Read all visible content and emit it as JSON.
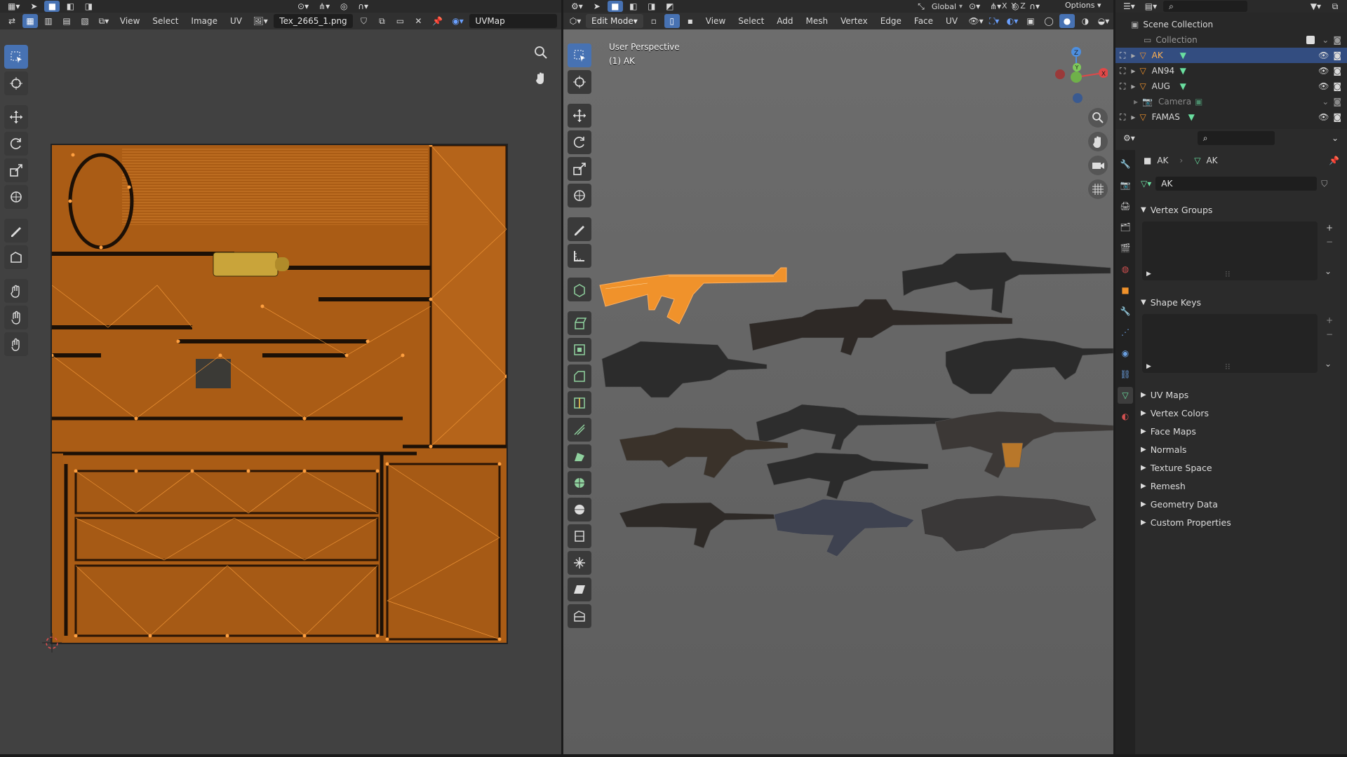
{
  "uv_editor": {
    "menus": [
      "View",
      "Select",
      "Image",
      "UV"
    ],
    "image_name": "Tex_2665_1.png",
    "uvmap_name": "UVMap"
  },
  "viewport": {
    "mode": "Edit Mode",
    "menus": [
      "View",
      "Select",
      "Add",
      "Mesh",
      "Vertex",
      "Edge",
      "Face",
      "UV"
    ],
    "transform_orientation": "Global",
    "axes": [
      "X",
      "Y",
      "Z"
    ],
    "options_label": "Options",
    "overlay_title": "User Perspective",
    "overlay_object": "(1) AK",
    "gizmo_labels": {
      "x": "X",
      "y": "Y",
      "z": "Z"
    }
  },
  "outliner": {
    "scene_collection": "Scene Collection",
    "collection": "Collection",
    "items": [
      {
        "name": "AK",
        "selected": true
      },
      {
        "name": "AN94",
        "selected": false
      },
      {
        "name": "AUG",
        "selected": false
      },
      {
        "name": "Camera",
        "selected": false
      },
      {
        "name": "FAMAS",
        "selected": false
      }
    ]
  },
  "properties": {
    "breadcrumb_object": "AK",
    "breadcrumb_mesh": "AK",
    "mesh_name": "AK",
    "panels_open": [
      "Vertex Groups",
      "Shape Keys"
    ],
    "panels_closed": [
      "UV Maps",
      "Vertex Colors",
      "Face Maps",
      "Normals",
      "Texture Space",
      "Remesh",
      "Geometry Data",
      "Custom Properties"
    ]
  },
  "colors": {
    "accent": "#4772b3",
    "selection_orange": "#f0922b",
    "header": "#303030"
  }
}
